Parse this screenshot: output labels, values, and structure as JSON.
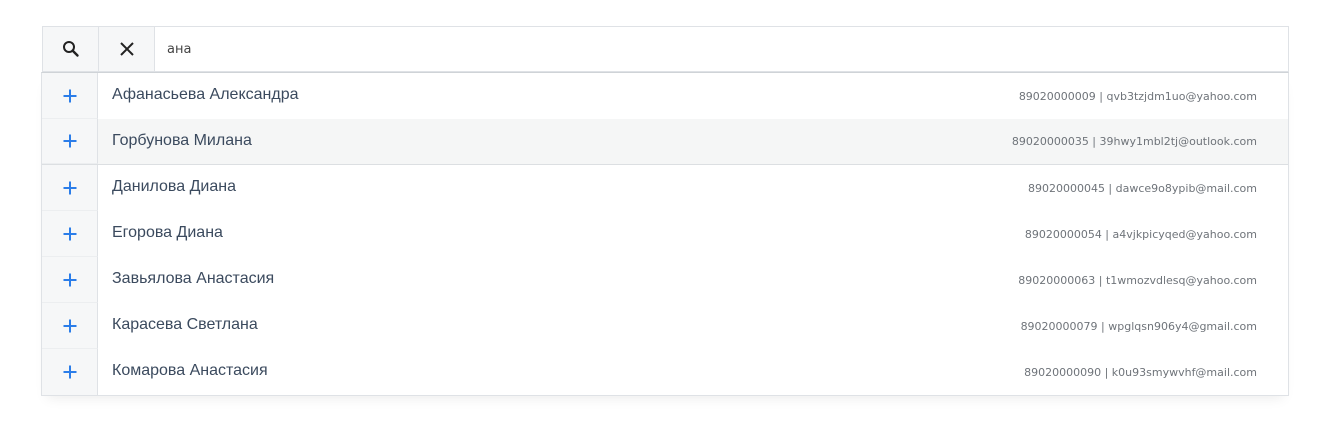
{
  "search": {
    "value": "ана",
    "search_icon": "search-icon",
    "clear_icon": "close-icon"
  },
  "colors": {
    "accent": "#2b7de9",
    "highlight_row": "#f5f6f6"
  },
  "results": [
    {
      "name": "Афанасьева Александра",
      "info": "89020000009 | qvb3tzjdm1uo@yahoo.com"
    },
    {
      "name": "Горбунова Милана",
      "info": "89020000035 | 39hwy1mbl2tj@outlook.com"
    },
    {
      "name": "Данилова Диана",
      "info": "89020000045 | dawce9o8ypib@mail.com"
    },
    {
      "name": "Егорова Диана",
      "info": "89020000054 | a4vjkpicyqed@yahoo.com"
    },
    {
      "name": "Завьялова Анастасия",
      "info": "89020000063 | t1wmozvdlesq@yahoo.com"
    },
    {
      "name": "Карасева Светлана",
      "info": "89020000079 | wpglqsn906y4@gmail.com"
    },
    {
      "name": "Комарова Анастасия",
      "info": "89020000090 | k0u93smywvhf@mail.com"
    }
  ]
}
